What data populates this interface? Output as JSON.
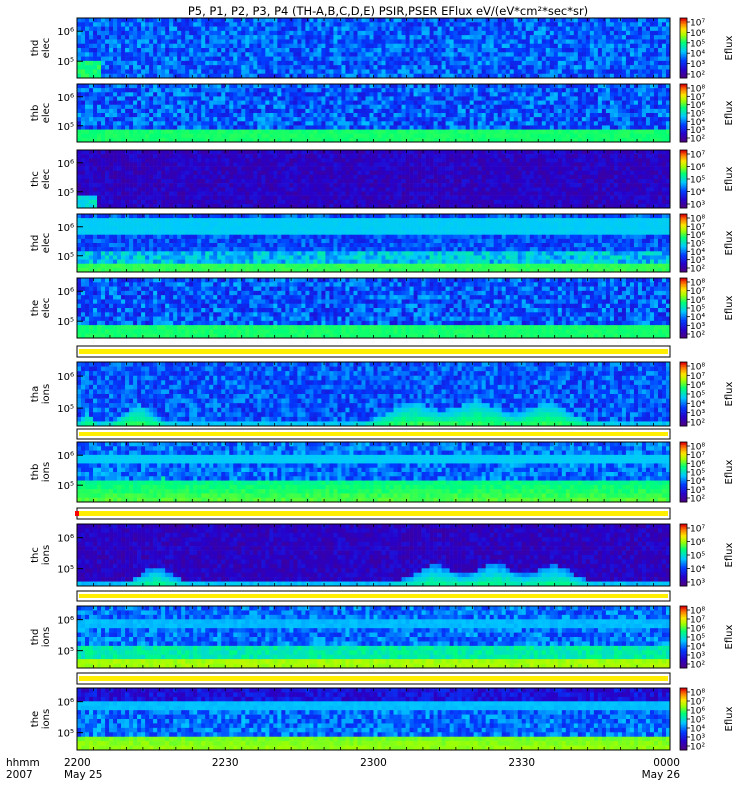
{
  "title": "P5, P1, P2, P3, P4 (TH-A,B,C,D,E) PSIR,PSER EFlux eV/(eV*cm²*sec*sr)",
  "colorbar_label": "Eflux",
  "panels": [
    {
      "probe": "thd",
      "species": "elec",
      "y_ticks": [
        "10⁶",
        "10⁵"
      ],
      "cb_ticks": [
        "10⁷",
        "10⁶",
        "10⁵",
        "10⁴",
        "10³",
        "10²"
      ],
      "pattern": "noise-low"
    },
    {
      "probe": "thb",
      "species": "elec",
      "y_ticks": [
        "10⁶",
        "10⁵"
      ],
      "cb_ticks": [
        "10⁸",
        "10⁷",
        "10⁶",
        "10⁵",
        "10⁴",
        "10³",
        "10²"
      ],
      "pattern": "band-low"
    },
    {
      "probe": "thc",
      "species": "elec",
      "y_ticks": [
        "10⁶",
        "10⁵"
      ],
      "cb_ticks": [
        "10⁷",
        "10⁶",
        "10⁵",
        "10⁴",
        "10³"
      ],
      "pattern": "noise-purple"
    },
    {
      "probe": "thd",
      "species": "elec",
      "y_ticks": [
        "10⁶",
        "10⁵"
      ],
      "cb_ticks": [
        "10⁸",
        "10⁷",
        "10⁶",
        "10⁵",
        "10⁴",
        "10³",
        "10²"
      ],
      "pattern": "band-high"
    },
    {
      "probe": "the",
      "species": "elec",
      "y_ticks": [
        "10⁶",
        "10⁵"
      ],
      "cb_ticks": [
        "10⁸",
        "10⁷",
        "10⁶",
        "10⁵",
        "10⁴",
        "10³",
        "10²"
      ],
      "pattern": "band-low"
    },
    {
      "probe": "tha",
      "species": "ions",
      "y_ticks": [
        "10⁶",
        "10⁵"
      ],
      "cb_ticks": [
        "10⁸",
        "10⁷",
        "10⁶",
        "10⁵",
        "10⁴",
        "10³",
        "10²"
      ],
      "pattern": "ion-bursts"
    },
    {
      "probe": "thb",
      "species": "ions",
      "y_ticks": [
        "10⁶",
        "10⁵"
      ],
      "cb_ticks": [
        "10⁸",
        "10⁷",
        "10⁶",
        "10⁵",
        "10⁴",
        "10³",
        "10²"
      ],
      "pattern": "ion-band"
    },
    {
      "probe": "thc",
      "species": "ions",
      "y_ticks": [
        "10⁶",
        "10⁵"
      ],
      "cb_ticks": [
        "10⁷",
        "10⁶",
        "10⁵",
        "10⁴",
        "10³"
      ],
      "pattern": "ion-purple"
    },
    {
      "probe": "thd",
      "species": "ions",
      "y_ticks": [
        "10⁶",
        "10⁵"
      ],
      "cb_ticks": [
        "10⁸",
        "10⁷",
        "10⁶",
        "10⁵",
        "10⁴",
        "10³",
        "10²"
      ],
      "pattern": "ion-band2"
    },
    {
      "probe": "the",
      "species": "ions",
      "y_ticks": [
        "10⁶",
        "10⁵"
      ],
      "cb_ticks": [
        "10⁸",
        "10⁷",
        "10⁶",
        "10⁵",
        "10⁴",
        "10³",
        "10²"
      ],
      "pattern": "ion-band3"
    }
  ],
  "x_axis": {
    "row_label_top": "hhmm",
    "row_label_bottom": "2007",
    "ticks": [
      {
        "t": 0,
        "label": "2200",
        "sub": "May 25"
      },
      {
        "t": 0.25,
        "label": "2230",
        "sub": ""
      },
      {
        "t": 0.5,
        "label": "2300",
        "sub": ""
      },
      {
        "t": 0.75,
        "label": "2330",
        "sub": ""
      },
      {
        "t": 1,
        "label": "0000",
        "sub": "May 26"
      }
    ]
  },
  "chart_data": {
    "type": "heatmap",
    "title": "P5, P1, P2, P3, P4 (TH-A,B,C,D,E) PSIR,PSER EFlux eV/(eV*cm²*sec*sr)",
    "x_ticks": [
      "2200",
      "2230",
      "2300",
      "2330",
      "0000"
    ],
    "x_dates": [
      "May 25",
      "May 26"
    ],
    "y_ticks": [
      "10⁵",
      "10⁶"
    ],
    "y_scale": "log",
    "colorbar_label": "Eflux",
    "colorbar_scale": "log",
    "series": [
      {
        "name": "thd elec"
      },
      {
        "name": "thb elec"
      },
      {
        "name": "thc elec"
      },
      {
        "name": "thd elec"
      },
      {
        "name": "the elec"
      },
      {
        "name": "tha ions"
      },
      {
        "name": "thb ions"
      },
      {
        "name": "thc ions"
      },
      {
        "name": "thd ions"
      },
      {
        "name": "the ions"
      }
    ],
    "grid": false
  }
}
